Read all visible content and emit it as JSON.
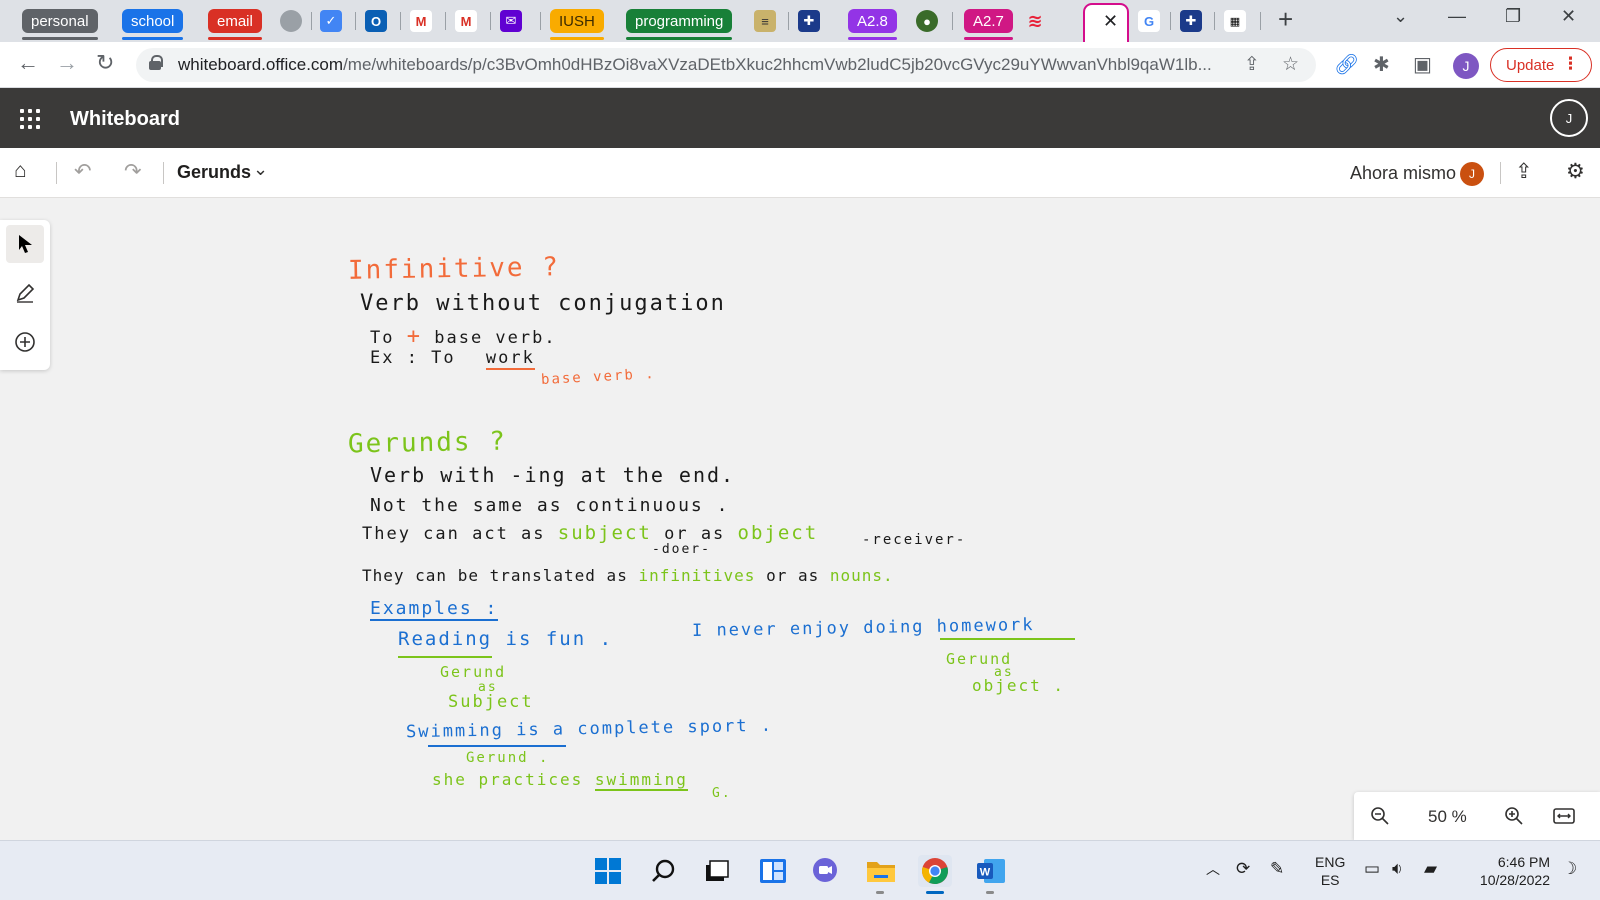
{
  "browser": {
    "tab_groups": [
      {
        "label": "personal",
        "color": "#5f6368"
      },
      {
        "label": "school",
        "color": "#1a73e8"
      },
      {
        "label": "email",
        "color": "#d93025"
      },
      {
        "label": "IUSH",
        "color": "#f9ab00"
      },
      {
        "label": "programming",
        "color": "#188038"
      },
      {
        "label": "A2.8",
        "color": "#9334e6"
      },
      {
        "label": "A2.7",
        "color": "#d01884"
      }
    ],
    "active_tab_close": "✕",
    "url_host": "whiteboard.office.com",
    "url_path": "/me/whiteboards/p/c3BvOmh0dHBzOi8vaXVzaDEtbXkuc2hhcmVwb2ludC5jb20vcGVyc29uYWwvanVhbl9qaW1lb...",
    "update_label": "Update"
  },
  "app": {
    "title": "Whiteboard",
    "avatar_initial": "J"
  },
  "board": {
    "name": "Gerunds",
    "saved_status": "Ahora mismo",
    "collaborator_initial": "J"
  },
  "zoom": {
    "level": "50 %"
  },
  "whiteboard_ink": {
    "colors": {
      "orange": "#f26b3a",
      "green": "#7cc41b",
      "blue": "#1b6fd1",
      "black": "#1a1a1a"
    },
    "infinitive_title": "Infinitive ?",
    "inf_line1": "Verb without conjugation",
    "inf_to": "To",
    "inf_plus": "+",
    "inf_base": "base verb.",
    "inf_ex": "Ex :  To",
    "inf_work": "work",
    "inf_work_note": "base verb .",
    "gerunds_title": "Gerunds ?",
    "ger_line1": "Verb with -ing at the end.",
    "ger_line2": "Not the same as continuous .",
    "ger_line3a": "They can act as",
    "ger_subject": "subject",
    "ger_or": "or as",
    "ger_object": "object",
    "ger_doer": "-doer-",
    "ger_receiver": "-receiver-",
    "ger_line4a": "They can be translated as",
    "ger_infinitives": "infinitives",
    "ger_line4b": "or as",
    "ger_nouns": "nouns.",
    "examples_title": "Examples :",
    "ex1_reading": "Reading",
    "ex1_rest": "is fun .",
    "ex1_note1": "Gerund",
    "ex1_note2": "as",
    "ex1_note3": "Subject",
    "ex2_text": "I never enjoy doing homework",
    "ex2_note1": "Gerund",
    "ex2_note2": "as",
    "ex2_note3": "object .",
    "ex3_text": "Swimming is a complete sport .",
    "ex3_note": "Gerund .",
    "ex4_a": "she practices",
    "ex4_b": "swimming",
    "ex4_note": "G."
  },
  "taskbar": {
    "lang_line1": "ENG",
    "lang_line2": "ES",
    "time": "6:46 PM",
    "date": "10/28/2022"
  }
}
